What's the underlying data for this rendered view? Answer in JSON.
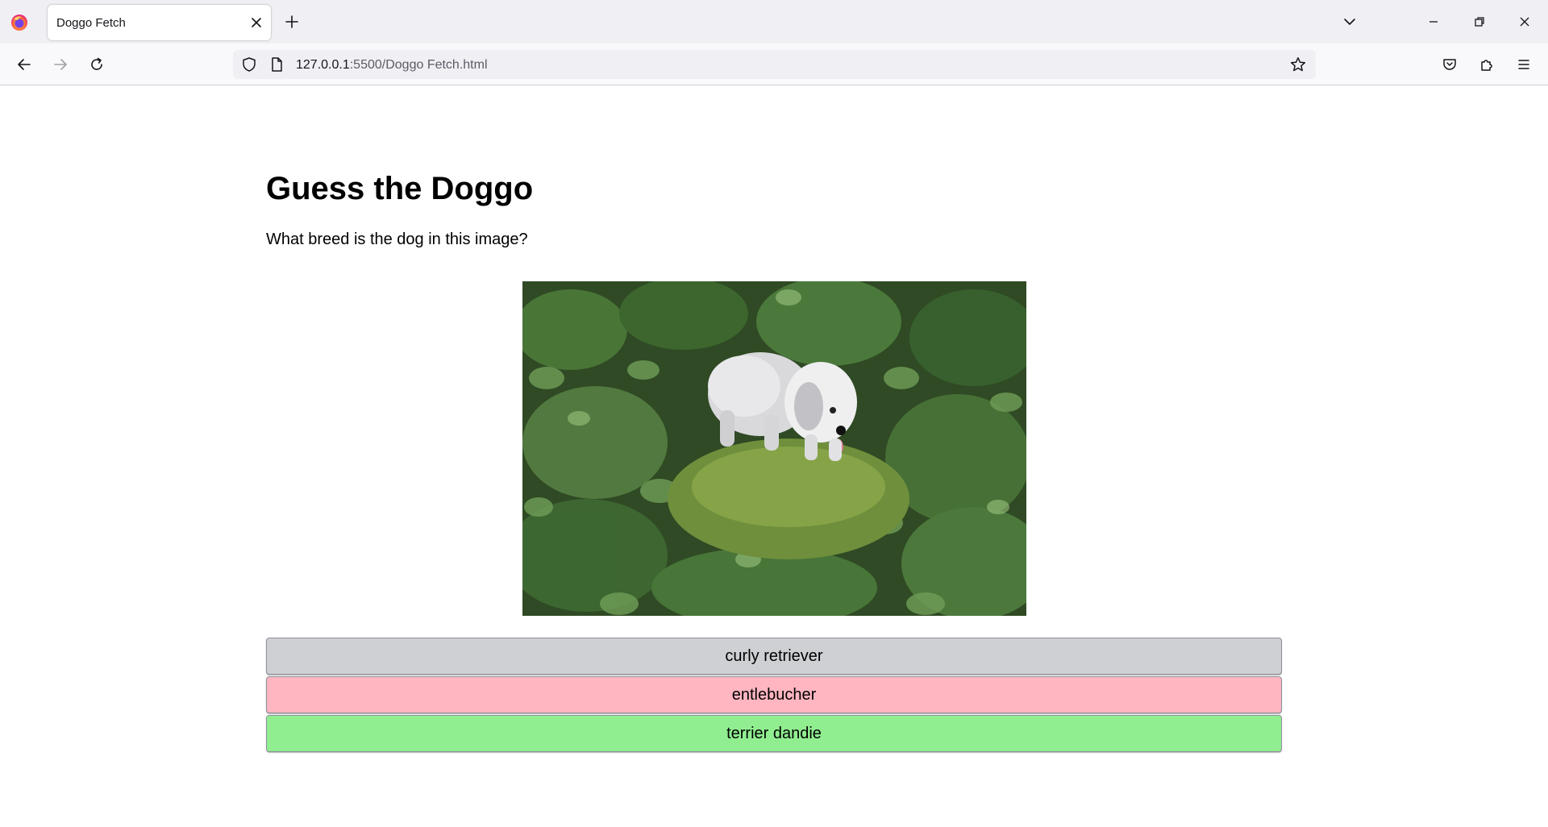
{
  "browser": {
    "tab": {
      "title": "Doggo Fetch"
    },
    "url": {
      "host": "127.0.0.1",
      "rest": ":5500/Doggo Fetch.html"
    }
  },
  "page": {
    "heading": "Guess the Doggo",
    "question": "What breed is the dog in this image?",
    "image": {
      "subject": "dog-photo"
    },
    "answers": [
      {
        "label": "curly retriever",
        "state": "neutral",
        "color": "#cfd0d4"
      },
      {
        "label": "entlebucher",
        "state": "wrong",
        "color": "#ffb6c1"
      },
      {
        "label": "terrier dandie",
        "state": "correct",
        "color": "#90ee90"
      }
    ]
  }
}
